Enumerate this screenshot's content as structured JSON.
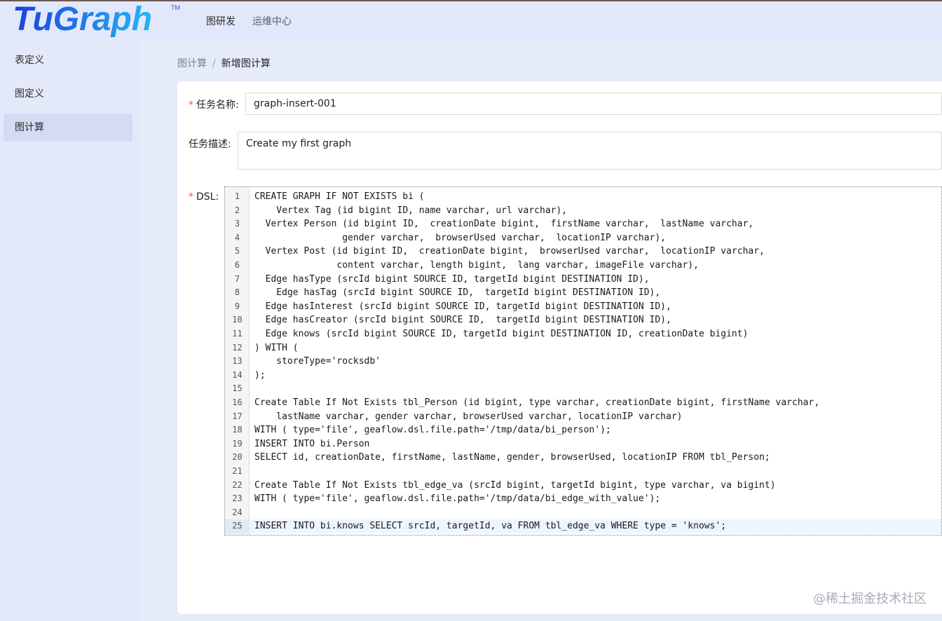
{
  "app": {
    "logo_text": "TuGraph",
    "logo_trademark": "TM"
  },
  "colors": {
    "brand": "#2f5bea",
    "required_marker": "#ff4d4f",
    "active_menu_bg": "#d4dbf3",
    "active_line_bg": "#eff5fd"
  },
  "header": {
    "nav": [
      "图研发",
      "运维中心"
    ]
  },
  "sidebar": {
    "items": [
      {
        "label": "表定义",
        "active": false
      },
      {
        "label": "图定义",
        "active": false
      },
      {
        "label": "图计算",
        "active": true
      }
    ]
  },
  "breadcrumb": {
    "parent": "图计算",
    "separator": "/",
    "current": "新增图计算"
  },
  "form": {
    "required_marker": "*",
    "name_label": "任务名称:",
    "name_value": "graph-insert-001",
    "desc_label": "任务描述:",
    "desc_value": "Create my first graph",
    "dsl_label": "DSL:",
    "dsl_lines": [
      "CREATE GRAPH IF NOT EXISTS bi (",
      "    Vertex Tag (id bigint ID, name varchar, url varchar),",
      "  Vertex Person (id bigint ID,  creationDate bigint,  firstName varchar,  lastName varchar,",
      "                gender varchar,  browserUsed varchar,  locationIP varchar),",
      "  Vertex Post (id bigint ID,  creationDate bigint,  browserUsed varchar,  locationIP varchar,",
      "               content varchar, length bigint,  lang varchar, imageFile varchar),",
      "  Edge hasType (srcId bigint SOURCE ID, targetId bigint DESTINATION ID),",
      "    Edge hasTag (srcId bigint SOURCE ID,  targetId bigint DESTINATION ID),",
      "  Edge hasInterest (srcId bigint SOURCE ID, targetId bigint DESTINATION ID),",
      "  Edge hasCreator (srcId bigint SOURCE ID,  targetId bigint DESTINATION ID),",
      "  Edge knows (srcId bigint SOURCE ID, targetId bigint DESTINATION ID, creationDate bigint)",
      ") WITH (",
      "    storeType='rocksdb'",
      ");",
      "",
      "Create Table If Not Exists tbl_Person (id bigint, type varchar, creationDate bigint, firstName varchar,",
      "    lastName varchar, gender varchar, browserUsed varchar, locationIP varchar)",
      "WITH ( type='file', geaflow.dsl.file.path='/tmp/data/bi_person');",
      "INSERT INTO bi.Person",
      "SELECT id, creationDate, firstName, lastName, gender, browserUsed, locationIP FROM tbl_Person;",
      "",
      "Create Table If Not Exists tbl_edge_va (srcId bigint, targetId bigint, type varchar, va bigint)",
      "WITH ( type='file', geaflow.dsl.file.path='/tmp/data/bi_edge_with_value');",
      "",
      "INSERT INTO bi.knows SELECT srcId, targetId, va FROM tbl_edge_va WHERE type = 'knows';"
    ],
    "active_line": 25
  },
  "watermark": "@稀土掘金技术社区"
}
